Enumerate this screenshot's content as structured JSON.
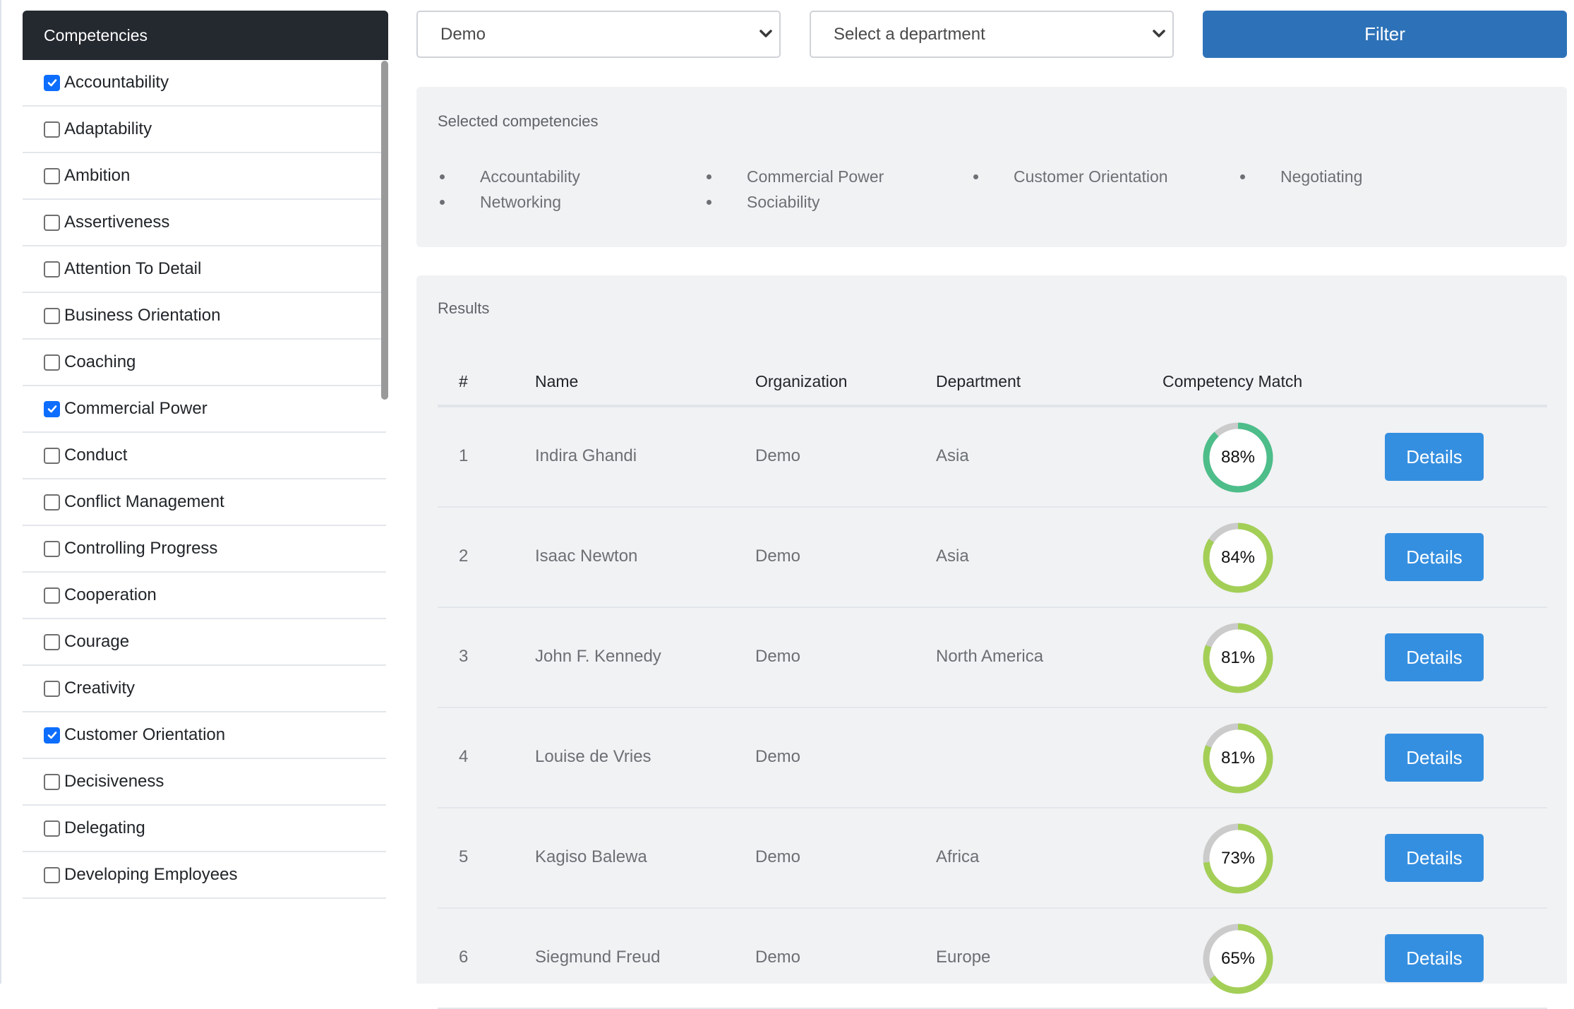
{
  "sidebar": {
    "title": "Competencies",
    "items": [
      {
        "label": "Accountability",
        "checked": true
      },
      {
        "label": "Adaptability",
        "checked": false
      },
      {
        "label": "Ambition",
        "checked": false
      },
      {
        "label": "Assertiveness",
        "checked": false
      },
      {
        "label": "Attention To Detail",
        "checked": false
      },
      {
        "label": "Business Orientation",
        "checked": false
      },
      {
        "label": "Coaching",
        "checked": false
      },
      {
        "label": "Commercial Power",
        "checked": true
      },
      {
        "label": "Conduct",
        "checked": false
      },
      {
        "label": "Conflict Management",
        "checked": false
      },
      {
        "label": "Controlling Progress",
        "checked": false
      },
      {
        "label": "Cooperation",
        "checked": false
      },
      {
        "label": "Courage",
        "checked": false
      },
      {
        "label": "Creativity",
        "checked": false
      },
      {
        "label": "Customer Orientation",
        "checked": true
      },
      {
        "label": "Decisiveness",
        "checked": false
      },
      {
        "label": "Delegating",
        "checked": false
      },
      {
        "label": "Developing Employees",
        "checked": false
      }
    ]
  },
  "filters": {
    "organization_value": "Demo",
    "department_placeholder": "Select a department",
    "filter_label": "Filter",
    "button_color": "#2d72b8"
  },
  "selected": {
    "title": "Selected competencies",
    "items": [
      "Accountability",
      "Commercial Power",
      "Customer Orientation",
      "Negotiating",
      "Networking",
      "Sociability"
    ]
  },
  "results": {
    "title": "Results",
    "headers": {
      "num": "#",
      "name": "Name",
      "org": "Organization",
      "dept": "Department",
      "match": "Competency Match"
    },
    "details_label": "Details",
    "colors": {
      "high": "#4dbd8a",
      "mid": "#a3cf56",
      "track": "#cbcbcb",
      "details": "#358fe0"
    },
    "rows": [
      {
        "num": "1",
        "name": "Indira Ghandi",
        "org": "Demo",
        "dept": "Asia",
        "match": 88,
        "match_label": "88%"
      },
      {
        "num": "2",
        "name": "Isaac Newton",
        "org": "Demo",
        "dept": "Asia",
        "match": 84,
        "match_label": "84%"
      },
      {
        "num": "3",
        "name": "John F. Kennedy",
        "org": "Demo",
        "dept": "North America",
        "match": 81,
        "match_label": "81%"
      },
      {
        "num": "4",
        "name": "Louise de Vries",
        "org": "Demo",
        "dept": "",
        "match": 81,
        "match_label": "81%"
      },
      {
        "num": "5",
        "name": "Kagiso Balewa",
        "org": "Demo",
        "dept": "Africa",
        "match": 73,
        "match_label": "73%"
      },
      {
        "num": "6",
        "name": "Siegmund Freud",
        "org": "Demo",
        "dept": "Europe",
        "match": 65,
        "match_label": "65%"
      }
    ]
  }
}
